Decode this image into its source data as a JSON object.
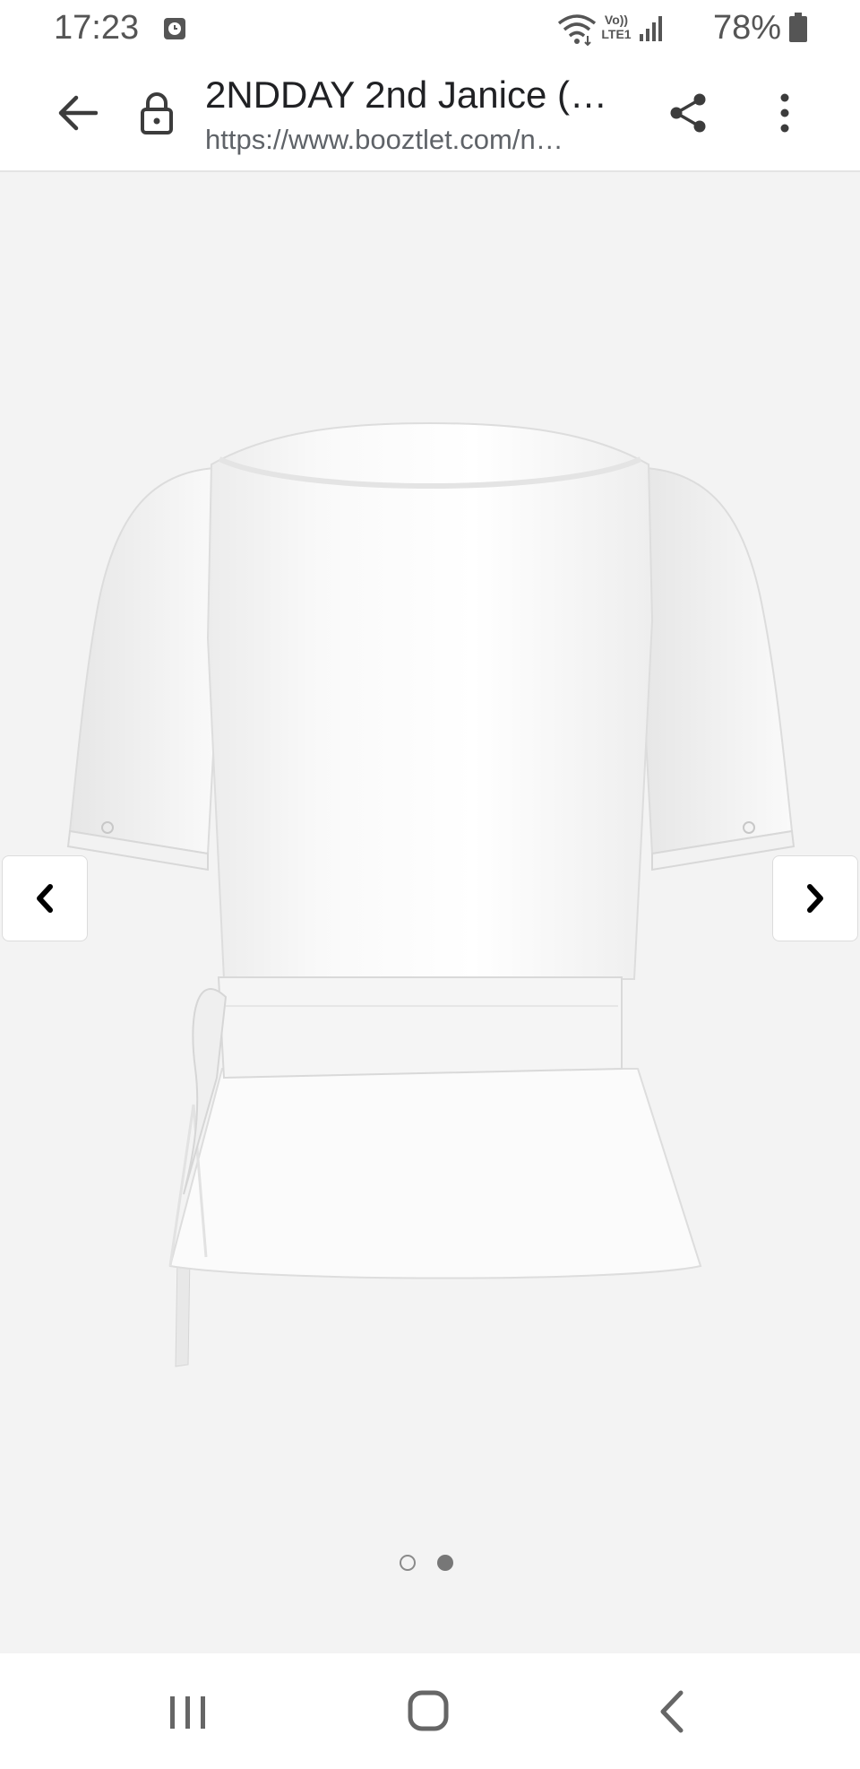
{
  "status_bar": {
    "time": "17:23",
    "volte_label_top": "Vo))",
    "volte_label_bottom": "LTE1",
    "battery": "78%",
    "icons": [
      "clock-icon",
      "wifi-icon",
      "signal-icon",
      "battery-icon"
    ]
  },
  "browser": {
    "title": "2NDDAY 2nd Janice (…",
    "url": "https://www.booztlet.com/n…",
    "icons": [
      "back-arrow-icon",
      "lock-icon",
      "share-icon",
      "more-vert-icon"
    ]
  },
  "gallery": {
    "current_slide": 2,
    "total_slides": 2,
    "icons": [
      "chevron-left-icon",
      "chevron-right-icon"
    ],
    "background_color": "#f3f3f3",
    "product_color": "#ffffff"
  },
  "system_nav": {
    "icons": [
      "recents-icon",
      "home-icon",
      "back-icon"
    ]
  }
}
